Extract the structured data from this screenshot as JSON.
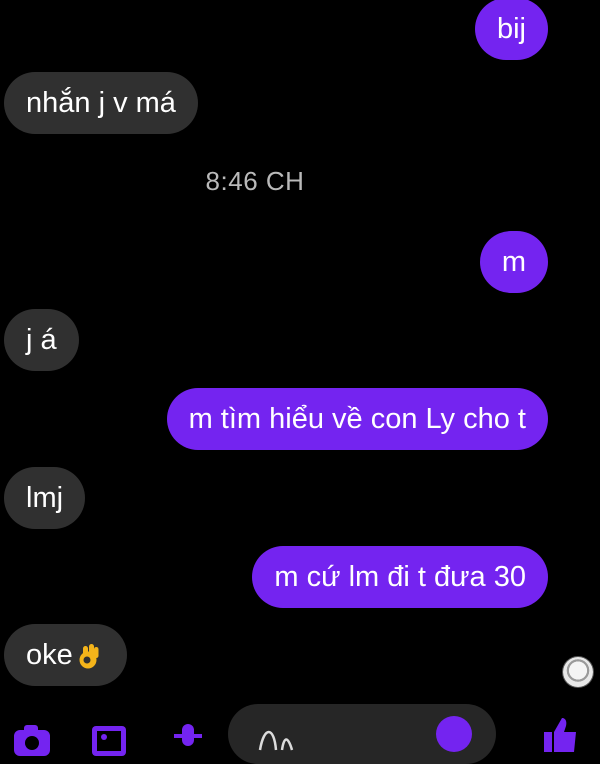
{
  "conversation": {
    "timestamp": "8:46 CH",
    "messages": [
      {
        "dir": "out",
        "text": "bij"
      },
      {
        "dir": "in",
        "text": "nhắn j v má"
      },
      {
        "dir": "out",
        "text": "m"
      },
      {
        "dir": "in",
        "text": "j á"
      },
      {
        "dir": "out",
        "text": "m tìm hiểu về con Ly cho t"
      },
      {
        "dir": "in",
        "text": "lmj"
      },
      {
        "dir": "out",
        "text": "m cứ lm đi t đưa 30"
      },
      {
        "dir": "in",
        "text": "oke",
        "emoji": "ok-hand-emoji"
      }
    ]
  },
  "composer": {
    "icons": [
      "camera-icon",
      "image-icon",
      "microphone-icon",
      "sticker-icon",
      "thumbs-up-icon"
    ]
  },
  "colors": {
    "background": "#000000",
    "outgoing_bubble": "#7424f0",
    "incoming_bubble": "#303030",
    "accent": "#7424f0"
  }
}
